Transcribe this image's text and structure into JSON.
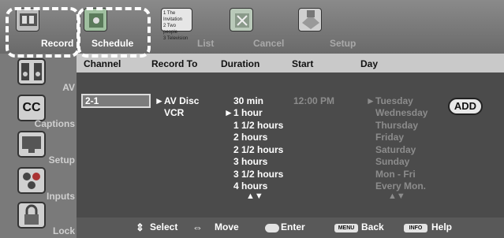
{
  "tabs": [
    {
      "label": "Record",
      "icon": "record-icon"
    },
    {
      "label": "Schedule",
      "icon": "schedule-icon"
    },
    {
      "label": "List",
      "icon": "list-icon"
    },
    {
      "label": "Cancel",
      "icon": "cancel-icon"
    },
    {
      "label": "Setup",
      "icon": "setup-icon"
    }
  ],
  "list_icon_lines": [
    "1 The Invitation",
    "2 Two people",
    "3 Television"
  ],
  "sidebar": [
    {
      "label": "AV",
      "icon": "speakers-icon"
    },
    {
      "label": "Captions",
      "icon": "cc-icon",
      "badge": "CC"
    },
    {
      "label": "Setup",
      "icon": "tv-setup-icon"
    },
    {
      "label": "Inputs",
      "icon": "inputs-icon"
    },
    {
      "label": "Lock",
      "icon": "lock-icon"
    }
  ],
  "columns": {
    "channel": "Channel",
    "record_to": "Record To",
    "duration": "Duration",
    "start": "Start",
    "day": "Day"
  },
  "channel_value": "2-1",
  "record_to": [
    {
      "label": "AV Disc",
      "selected": true
    },
    {
      "label": "VCR",
      "selected": false
    }
  ],
  "durations": [
    {
      "label": "30 min",
      "selected": false
    },
    {
      "label": "1 hour",
      "selected": true
    },
    {
      "label": "1 1/2 hours",
      "selected": false
    },
    {
      "label": "2 hours",
      "selected": false
    },
    {
      "label": "2 1/2 hours",
      "selected": false
    },
    {
      "label": "3 hours",
      "selected": false
    },
    {
      "label": "3 1/2 hours",
      "selected": false
    },
    {
      "label": "4 hours",
      "selected": false
    }
  ],
  "start_time": "12:00 PM",
  "days": [
    {
      "label": "Tuesday",
      "selected": true
    },
    {
      "label": "Wednesday",
      "selected": false
    },
    {
      "label": "Thursday",
      "selected": false
    },
    {
      "label": "Friday",
      "selected": false
    },
    {
      "label": "Saturday",
      "selected": false
    },
    {
      "label": "Sunday",
      "selected": false
    },
    {
      "label": "Mon - Fri",
      "selected": false
    },
    {
      "label": "Every Mon.",
      "selected": false
    }
  ],
  "add_label": "ADD",
  "hints": [
    {
      "key": "",
      "label": "Select",
      "icon": "updown-arrows-icon"
    },
    {
      "key": "",
      "label": "Move",
      "icon": "leftright-arrows-icon"
    },
    {
      "key": "",
      "label": "Enter",
      "icon": "enter-button-icon"
    },
    {
      "key": "MENU",
      "label": "Back",
      "icon": "menu-key-icon"
    },
    {
      "key": "INFO",
      "label": "Help",
      "icon": "info-key-icon"
    }
  ],
  "colors": {
    "panel": "#4b4b4b",
    "header": "#c9c9c9",
    "focus": "#ffffff",
    "dim_text": "#8c8c8c"
  }
}
